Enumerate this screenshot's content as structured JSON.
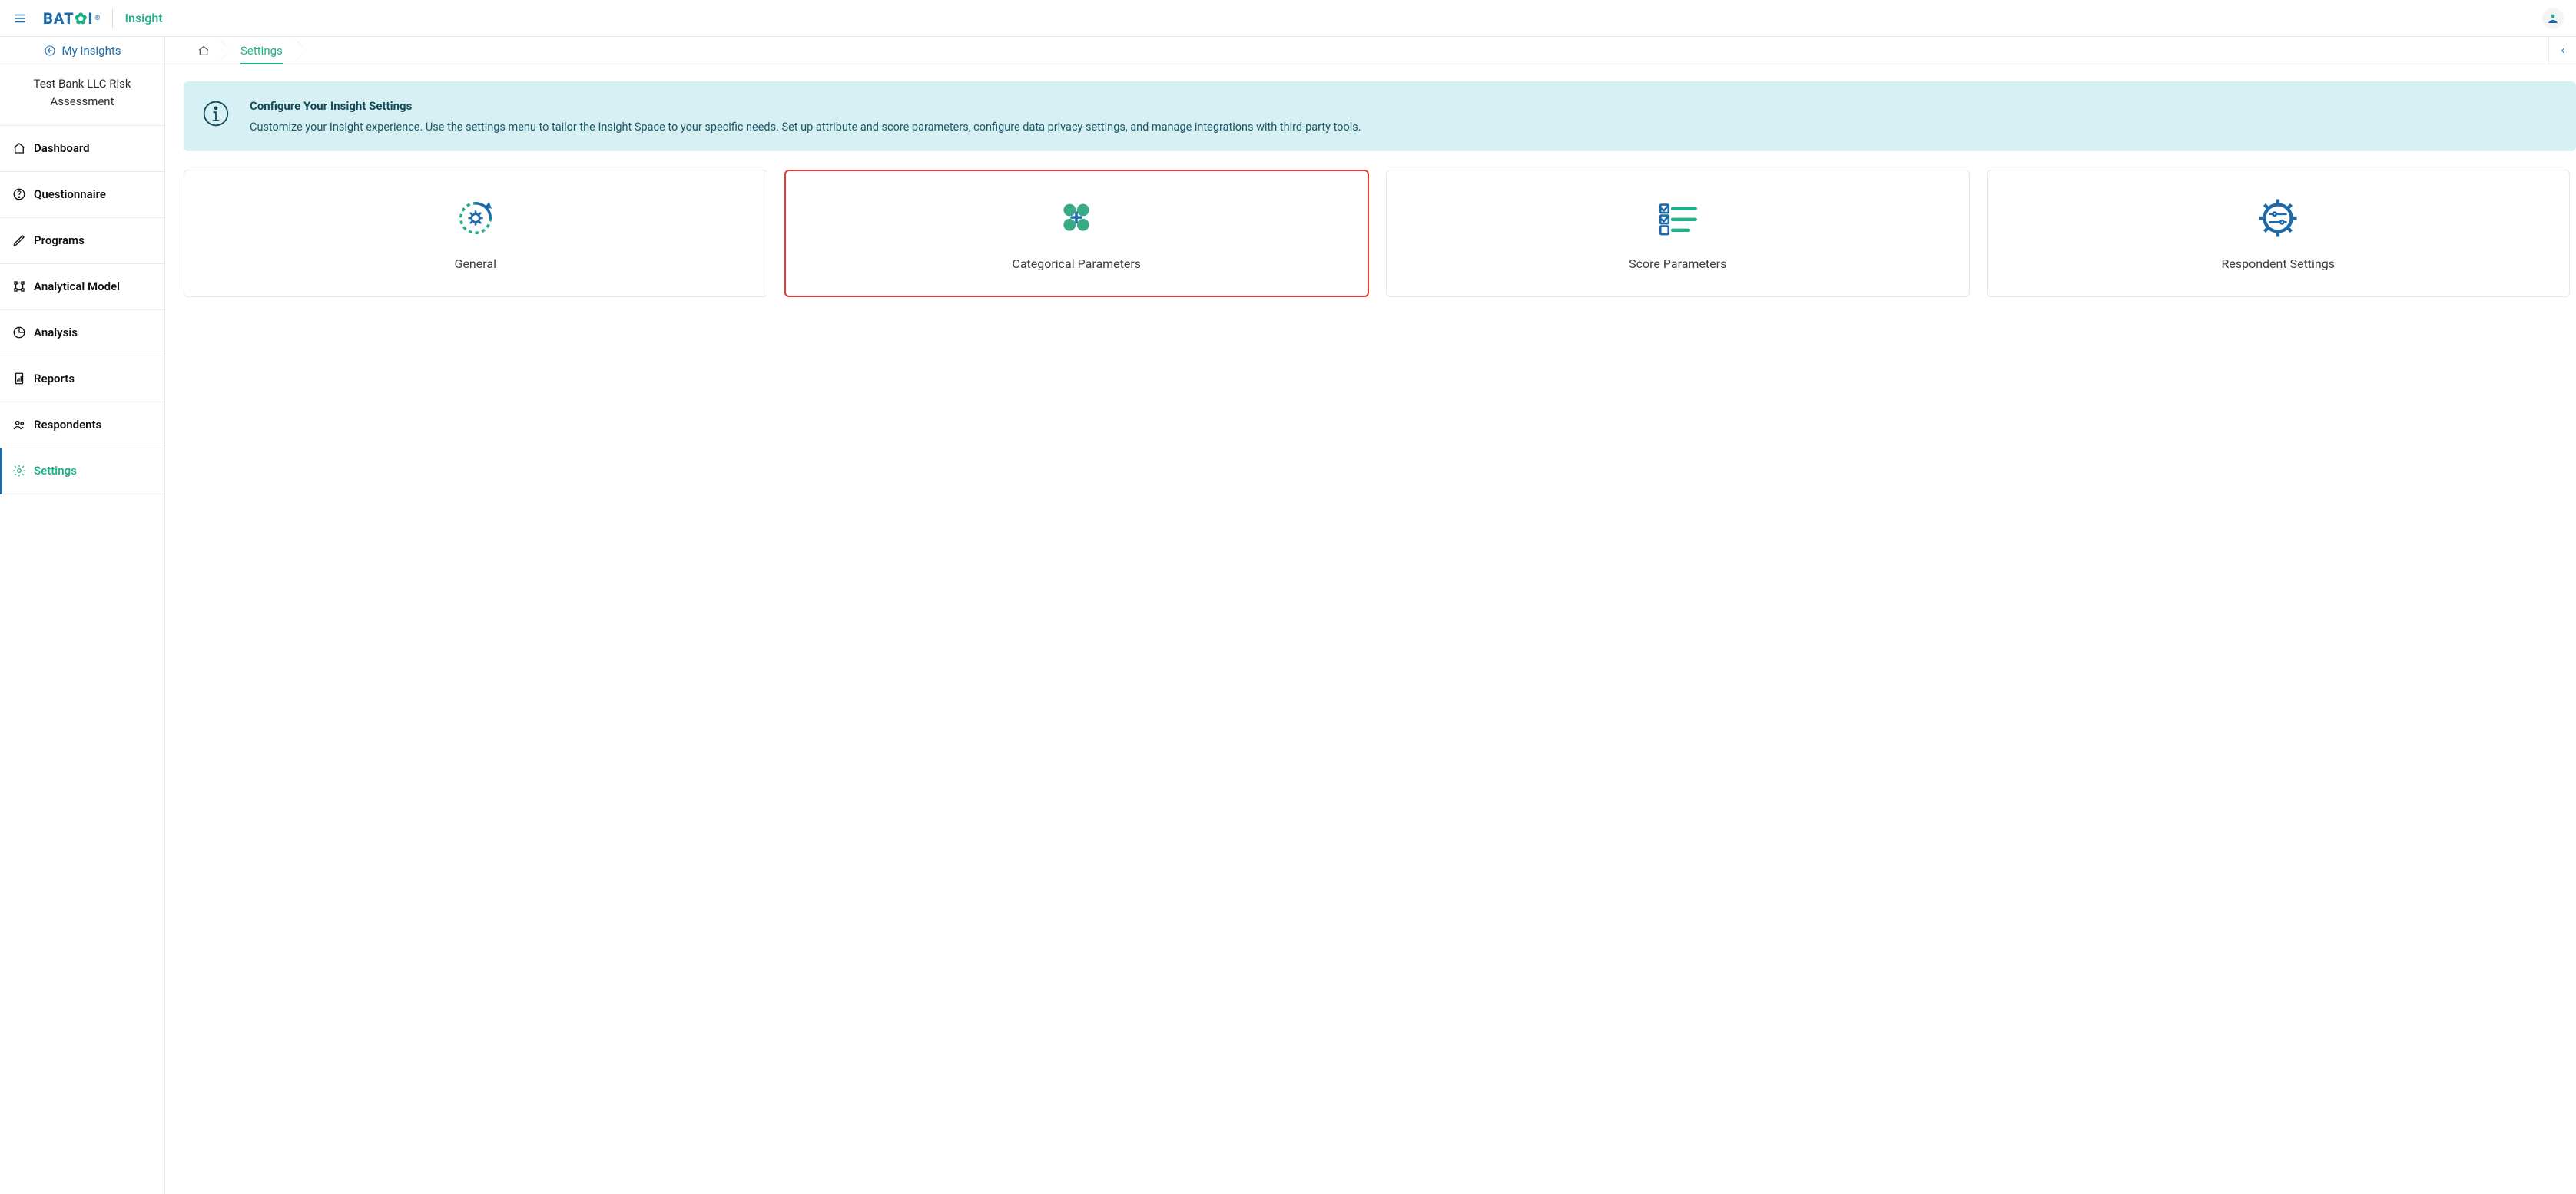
{
  "header": {
    "brand": "BAT",
    "brand_suffix": "I",
    "app_name": "Insight"
  },
  "sidebar": {
    "back_label": "My Insights",
    "workspace_title": "Test Bank LLC Risk Assessment",
    "items": [
      {
        "label": "Dashboard"
      },
      {
        "label": "Questionnaire"
      },
      {
        "label": "Programs"
      },
      {
        "label": "Analytical Model"
      },
      {
        "label": "Analysis"
      },
      {
        "label": "Reports"
      },
      {
        "label": "Respondents"
      },
      {
        "label": "Settings"
      }
    ],
    "active_index": 7
  },
  "breadcrumb": {
    "current": "Settings"
  },
  "banner": {
    "title": "Configure Your Insight Settings",
    "body": "Customize your Insight experience. Use the settings menu to tailor the Insight Space to your specific needs. Set up attribute and score parameters, configure data privacy settings, and manage integrations with third-party tools."
  },
  "cards": [
    {
      "label": "General"
    },
    {
      "label": "Categorical Parameters"
    },
    {
      "label": "Score Parameters"
    },
    {
      "label": "Respondent Settings"
    }
  ],
  "highlight_card_index": 1
}
